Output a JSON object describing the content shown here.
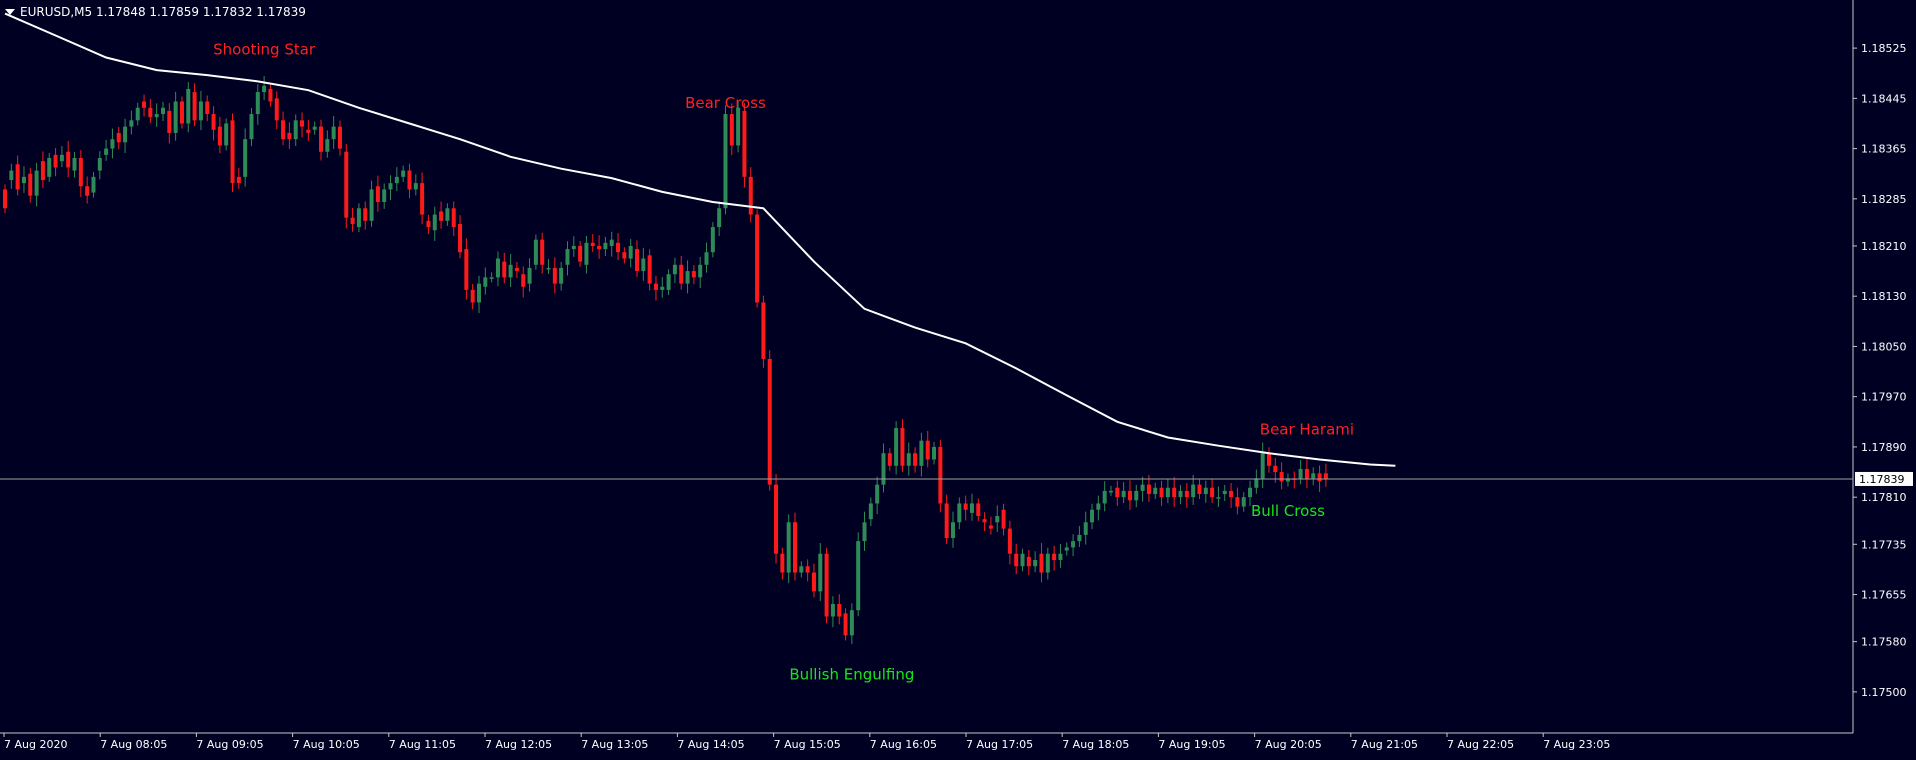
{
  "header": {
    "symbol_line": "EURUSD,M5  1.17848 1.17859 1.17832 1.17839"
  },
  "colors": {
    "background": "#000022",
    "frame": "#c8c8c8",
    "bull": "#2e8b57",
    "bear": "#ff1a1a",
    "ma_line": "#ffffff",
    "label_bear": "#ff2020",
    "label_bull": "#19e619",
    "text": "#ffffff"
  },
  "chart_data": {
    "type": "candlestick",
    "symbol": "EURUSD",
    "timeframe": "M5",
    "last_price": 1.17839,
    "ylim": [
      1.1746,
      1.186
    ],
    "y_ticks": [
      "1.18525",
      "1.18445",
      "1.18365",
      "1.18285",
      "1.18210",
      "1.18130",
      "1.18050",
      "1.17970",
      "1.17890",
      "1.17810",
      "1.17735",
      "1.17655",
      "1.17580",
      "1.17500"
    ],
    "x_ticks": [
      "7 Aug 2020",
      "7 Aug 08:05",
      "7 Aug 09:05",
      "7 Aug 10:05",
      "7 Aug 11:05",
      "7 Aug 12:05",
      "7 Aug 13:05",
      "7 Aug 14:05",
      "7 Aug 15:05",
      "7 Aug 16:05",
      "7 Aug 17:05",
      "7 Aug 18:05",
      "7 Aug 19:05",
      "7 Aug 20:05",
      "7 Aug 21:05",
      "7 Aug 22:05",
      "7 Aug 23:05"
    ],
    "price_line_label": "1.17839",
    "moving_average": [
      [
        0,
        1.1858
      ],
      [
        8,
        1.18545
      ],
      [
        16,
        1.1851
      ],
      [
        24,
        1.1849
      ],
      [
        32,
        1.18482
      ],
      [
        40,
        1.18472
      ],
      [
        48,
        1.18458
      ],
      [
        56,
        1.1843
      ],
      [
        64,
        1.18405
      ],
      [
        72,
        1.1838
      ],
      [
        80,
        1.18352
      ],
      [
        88,
        1.18333
      ],
      [
        96,
        1.18318
      ],
      [
        104,
        1.18296
      ],
      [
        112,
        1.1828
      ],
      [
        116,
        1.18275
      ],
      [
        120,
        1.1827
      ],
      [
        128,
        1.18185
      ],
      [
        136,
        1.1811
      ],
      [
        144,
        1.1808
      ],
      [
        152,
        1.18055
      ],
      [
        160,
        1.18015
      ],
      [
        168,
        1.17972
      ],
      [
        176,
        1.1793
      ],
      [
        184,
        1.17905
      ],
      [
        192,
        1.17892
      ],
      [
        200,
        1.1788
      ],
      [
        208,
        1.1787
      ],
      [
        216,
        1.17862
      ],
      [
        220,
        1.1786
      ]
    ],
    "annotations": [
      {
        "text": "Shooting Star",
        "bar": 41,
        "price": 1.18515,
        "type": "bear"
      },
      {
        "text": "Bear Cross",
        "bar": 114,
        "price": 1.1843,
        "type": "bear"
      },
      {
        "text": "Bullish Engulfing",
        "bar": 134,
        "price": 1.1752,
        "type": "bull"
      },
      {
        "text": "Bear Harami",
        "bar": 206,
        "price": 1.1791,
        "type": "bear"
      },
      {
        "text": "Bull Cross",
        "bar": 203,
        "price": 1.1778,
        "type": "bull"
      }
    ],
    "candles": [
      [
        0,
        1.183,
        1.1827
      ],
      [
        1,
        1.18315,
        1.1833
      ],
      [
        2,
        1.1834,
        1.183
      ],
      [
        3,
        1.1831,
        1.1832
      ],
      [
        4,
        1.18325,
        1.1829
      ],
      [
        5,
        1.1829,
        1.1833
      ],
      [
        6,
        1.18345,
        1.18315
      ],
      [
        7,
        1.1832,
        1.1835
      ],
      [
        8,
        1.18355,
        1.18335
      ],
      [
        9,
        1.18345,
        1.18355
      ],
      [
        10,
        1.1836,
        1.18335
      ],
      [
        11,
        1.1833,
        1.1835
      ],
      [
        12,
        1.1835,
        1.18305
      ],
      [
        13,
        1.18305,
        1.1829
      ],
      [
        14,
        1.18295,
        1.1832
      ],
      [
        15,
        1.1833,
        1.1835
      ],
      [
        16,
        1.18355,
        1.18365
      ],
      [
        17,
        1.18365,
        1.1838
      ],
      [
        18,
        1.1839,
        1.18375
      ],
      [
        19,
        1.18375,
        1.184
      ],
      [
        20,
        1.184,
        1.1841
      ],
      [
        21,
        1.1841,
        1.1843
      ],
      [
        22,
        1.1844,
        1.1843
      ],
      [
        23,
        1.1843,
        1.18415
      ],
      [
        24,
        1.18415,
        1.1842
      ],
      [
        25,
        1.1842,
        1.1843
      ],
      [
        26,
        1.18425,
        1.1839
      ],
      [
        27,
        1.1839,
        1.1844
      ],
      [
        28,
        1.1844,
        1.18405
      ],
      [
        29,
        1.18405,
        1.1846
      ],
      [
        30,
        1.18455,
        1.1841
      ],
      [
        31,
        1.1841,
        1.1844
      ],
      [
        32,
        1.1844,
        1.1842
      ],
      [
        33,
        1.1842,
        1.18395
      ],
      [
        34,
        1.184,
        1.1837
      ],
      [
        35,
        1.1837,
        1.18405
      ],
      [
        36,
        1.1841,
        1.1831
      ],
      [
        37,
        1.1832,
        1.1831
      ],
      [
        38,
        1.1832,
        1.1838
      ],
      [
        39,
        1.1838,
        1.1842
      ],
      [
        40,
        1.1842,
        1.18455
      ],
      [
        41,
        1.18455,
        1.18465
      ],
      [
        42,
        1.1846,
        1.1844
      ],
      [
        43,
        1.18445,
        1.1841
      ],
      [
        44,
        1.1841,
        1.1838
      ],
      [
        45,
        1.1839,
        1.1838
      ],
      [
        46,
        1.1838,
        1.1841
      ],
      [
        47,
        1.1841,
        1.184
      ],
      [
        48,
        1.18395,
        1.1839
      ],
      [
        49,
        1.18395,
        1.184
      ],
      [
        50,
        1.184,
        1.1836
      ],
      [
        51,
        1.1836,
        1.1838
      ],
      [
        52,
        1.1838,
        1.184
      ],
      [
        53,
        1.184,
        1.18365
      ],
      [
        54,
        1.1836,
        1.18255
      ],
      [
        55,
        1.18255,
        1.18245
      ],
      [
        56,
        1.1824,
        1.1827
      ],
      [
        57,
        1.1827,
        1.1825
      ],
      [
        58,
        1.1825,
        1.183
      ],
      [
        59,
        1.18305,
        1.1828
      ],
      [
        60,
        1.1828,
        1.183
      ],
      [
        61,
        1.183,
        1.1831
      ],
      [
        62,
        1.1831,
        1.1832
      ],
      [
        63,
        1.1832,
        1.1833
      ],
      [
        64,
        1.1833,
        1.183
      ],
      [
        65,
        1.183,
        1.1831
      ],
      [
        66,
        1.1831,
        1.1826
      ],
      [
        67,
        1.1825,
        1.1824
      ],
      [
        68,
        1.18235,
        1.1826
      ],
      [
        69,
        1.18265,
        1.1825
      ],
      [
        70,
        1.1825,
        1.1827
      ],
      [
        71,
        1.1827,
        1.1824
      ],
      [
        72,
        1.18245,
        1.182
      ],
      [
        73,
        1.18205,
        1.1814
      ],
      [
        74,
        1.1814,
        1.1812
      ],
      [
        75,
        1.1812,
        1.1815
      ],
      [
        76,
        1.18145,
        1.1816
      ],
      [
        77,
        1.1816,
        1.1816
      ],
      [
        78,
        1.1816,
        1.1819
      ],
      [
        79,
        1.18185,
        1.1816
      ],
      [
        80,
        1.1816,
        1.1818
      ],
      [
        81,
        1.18175,
        1.1817
      ],
      [
        82,
        1.18165,
        1.18145
      ],
      [
        83,
        1.1815,
        1.18175
      ],
      [
        84,
        1.1818,
        1.1822
      ],
      [
        85,
        1.1822,
        1.1818
      ],
      [
        86,
        1.18175,
        1.18175
      ],
      [
        87,
        1.18175,
        1.1815
      ],
      [
        88,
        1.1815,
        1.18175
      ],
      [
        89,
        1.1818,
        1.18205
      ],
      [
        90,
        1.18205,
        1.1821
      ],
      [
        91,
        1.1821,
        1.18185
      ],
      [
        92,
        1.1818,
        1.18215
      ],
      [
        93,
        1.18215,
        1.1821
      ],
      [
        94,
        1.1821,
        1.18205
      ],
      [
        95,
        1.18205,
        1.18215
      ],
      [
        96,
        1.1821,
        1.1822
      ],
      [
        97,
        1.18215,
        1.182
      ],
      [
        98,
        1.182,
        1.1819
      ],
      [
        99,
        1.1819,
        1.1821
      ],
      [
        100,
        1.18205,
        1.1817
      ],
      [
        101,
        1.1817,
        1.1819
      ],
      [
        102,
        1.18195,
        1.1815
      ],
      [
        103,
        1.1815,
        1.1814
      ],
      [
        104,
        1.1814,
        1.18145
      ],
      [
        105,
        1.1814,
        1.18165
      ],
      [
        106,
        1.18165,
        1.1818
      ],
      [
        107,
        1.1818,
        1.1815
      ],
      [
        108,
        1.1815,
        1.1817
      ],
      [
        109,
        1.1817,
        1.1816
      ],
      [
        110,
        1.1816,
        1.1818
      ],
      [
        111,
        1.1818,
        1.182
      ],
      [
        112,
        1.182,
        1.1824
      ],
      [
        113,
        1.1824,
        1.1827
      ],
      [
        114,
        1.1827,
        1.1842
      ],
      [
        115,
        1.1842,
        1.1837
      ],
      [
        116,
        1.1837,
        1.1843
      ],
      [
        117,
        1.18425,
        1.1832
      ],
      [
        118,
        1.1832,
        1.1826
      ],
      [
        119,
        1.1826,
        1.1812
      ],
      [
        120,
        1.1812,
        1.1803
      ],
      [
        121,
        1.1803,
        1.1783
      ],
      [
        122,
        1.1783,
        1.1772
      ],
      [
        123,
        1.1772,
        1.1769
      ],
      [
        124,
        1.1769,
        1.1777
      ],
      [
        125,
        1.1777,
        1.1769
      ],
      [
        126,
        1.1769,
        1.177
      ],
      [
        127,
        1.177,
        1.1769
      ],
      [
        128,
        1.1769,
        1.1766
      ],
      [
        129,
        1.1766,
        1.1772
      ],
      [
        130,
        1.1772,
        1.1762
      ],
      [
        131,
        1.1762,
        1.1764
      ],
      [
        132,
        1.1764,
        1.1762
      ],
      [
        133,
        1.17625,
        1.1759
      ],
      [
        134,
        1.1759,
        1.1763
      ],
      [
        135,
        1.1763,
        1.1774
      ],
      [
        136,
        1.1774,
        1.1777
      ],
      [
        137,
        1.17775,
        1.178
      ],
      [
        138,
        1.178,
        1.1783
      ],
      [
        139,
        1.1783,
        1.1788
      ],
      [
        140,
        1.1788,
        1.1786
      ],
      [
        141,
        1.1786,
        1.1792
      ],
      [
        142,
        1.1792,
        1.1786
      ],
      [
        143,
        1.1786,
        1.1788
      ],
      [
        144,
        1.1788,
        1.1786
      ],
      [
        145,
        1.1786,
        1.179
      ],
      [
        146,
        1.179,
        1.1787
      ],
      [
        147,
        1.1787,
        1.1789
      ],
      [
        148,
        1.1789,
        1.178
      ],
      [
        149,
        1.178,
        1.17745
      ],
      [
        150,
        1.17745,
        1.1777
      ],
      [
        151,
        1.1777,
        1.178
      ],
      [
        152,
        1.178,
        1.1779
      ],
      [
        153,
        1.17785,
        1.178
      ],
      [
        154,
        1.178,
        1.1778
      ],
      [
        155,
        1.17775,
        1.1777
      ],
      [
        156,
        1.17765,
        1.1776
      ],
      [
        157,
        1.1777,
        1.1778
      ],
      [
        158,
        1.1779,
        1.1776
      ],
      [
        159,
        1.1776,
        1.1772
      ],
      [
        160,
        1.1772,
        1.177
      ],
      [
        161,
        1.177,
        1.1772
      ],
      [
        162,
        1.17715,
        1.177
      ],
      [
        163,
        1.177,
        1.1771
      ],
      [
        164,
        1.1772,
        1.1769
      ],
      [
        165,
        1.1769,
        1.1772
      ],
      [
        166,
        1.1772,
        1.1771
      ],
      [
        167,
        1.1771,
        1.1772
      ],
      [
        168,
        1.17725,
        1.1773
      ],
      [
        169,
        1.1773,
        1.1774
      ],
      [
        170,
        1.1774,
        1.1775
      ],
      [
        171,
        1.1775,
        1.1777
      ],
      [
        172,
        1.1777,
        1.1779
      ],
      [
        173,
        1.1779,
        1.178
      ],
      [
        174,
        1.178,
        1.1782
      ],
      [
        175,
        1.1782,
        1.1782
      ],
      [
        176,
        1.17825,
        1.1781
      ],
      [
        177,
        1.1781,
        1.1782
      ],
      [
        178,
        1.1782,
        1.17805
      ],
      [
        179,
        1.17805,
        1.1782
      ],
      [
        180,
        1.1782,
        1.1783
      ],
      [
        181,
        1.1783,
        1.17815
      ],
      [
        182,
        1.17815,
        1.17825
      ],
      [
        183,
        1.17825,
        1.1781
      ],
      [
        184,
        1.1781,
        1.17825
      ],
      [
        185,
        1.17825,
        1.1781
      ],
      [
        186,
        1.1781,
        1.1782
      ],
      [
        187,
        1.1782,
        1.1781
      ],
      [
        188,
        1.1781,
        1.1783
      ],
      [
        189,
        1.1783,
        1.17815
      ],
      [
        190,
        1.17815,
        1.17825
      ],
      [
        191,
        1.17825,
        1.1781
      ],
      [
        192,
        1.1781,
        1.1781
      ],
      [
        193,
        1.17815,
        1.1782
      ],
      [
        194,
        1.1782,
        1.1781
      ],
      [
        195,
        1.1781,
        1.17795
      ],
      [
        196,
        1.17795,
        1.1781
      ],
      [
        197,
        1.1781,
        1.17825
      ],
      [
        198,
        1.17825,
        1.1784
      ],
      [
        199,
        1.1784,
        1.1788
      ],
      [
        200,
        1.1788,
        1.1786
      ],
      [
        201,
        1.1786,
        1.1785
      ],
      [
        202,
        1.1785,
        1.17835
      ],
      [
        203,
        1.17835,
        1.1784
      ],
      [
        204,
        1.1784,
        1.17838
      ],
      [
        205,
        1.1784,
        1.17855
      ],
      [
        206,
        1.17855,
        1.1784
      ],
      [
        207,
        1.1784,
        1.17848
      ],
      [
        208,
        1.17848,
        1.17835
      ],
      [
        209,
        1.17848,
        1.17839
      ]
    ]
  }
}
